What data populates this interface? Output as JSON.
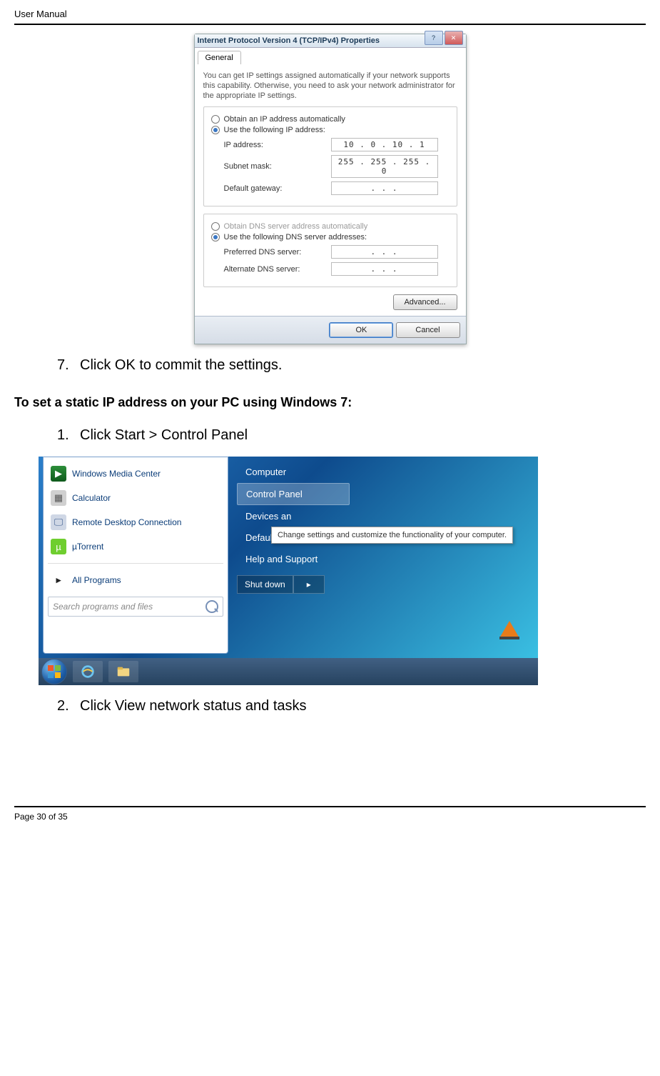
{
  "header": {
    "title": "User Manual"
  },
  "footer": {
    "page_label": "Page 30 of 35"
  },
  "steps_a": [
    {
      "num": "7.",
      "text": "Click OK to commit the settings."
    }
  ],
  "section_heading": "To set a static IP address on your PC using Windows 7:",
  "steps_b": [
    {
      "num": "1.",
      "text": "Click Start > Control Panel"
    },
    {
      "num": "2.",
      "text": "Click View network status and tasks"
    }
  ],
  "dialog": {
    "title": "Internet Protocol Version 4 (TCP/IPv4) Properties",
    "tab": "General",
    "body_text": "You can get IP settings assigned automatically if your network supports this capability. Otherwise, you need to ask your network administrator for the appropriate IP settings.",
    "opt_auto_ip": "Obtain an IP address automatically",
    "opt_use_ip": "Use the following IP address:",
    "lbl_ip": "IP address:",
    "val_ip": "10 .  0  . 10 .  1",
    "lbl_mask": "Subnet mask:",
    "val_mask": "255 . 255 . 255 .  0",
    "lbl_gw": "Default gateway:",
    "val_gw": ".      .      .",
    "opt_auto_dns": "Obtain DNS server address automatically",
    "opt_use_dns": "Use the following DNS server addresses:",
    "lbl_pref": "Preferred DNS server:",
    "val_pref": ".      .      .",
    "lbl_alt": "Alternate DNS server:",
    "val_alt": ".      .      .",
    "btn_advanced": "Advanced...",
    "btn_ok": "OK",
    "btn_cancel": "Cancel"
  },
  "startmenu": {
    "left_items": [
      "Windows Media Center",
      "Calculator",
      "Remote Desktop Connection",
      "µTorrent"
    ],
    "all_programs": "All Programs",
    "search_placeholder": "Search programs and files",
    "right_top_item": "Computer",
    "right_items": [
      "Control Panel",
      "Devices an",
      "Default Programs",
      "Help and Support"
    ],
    "shutdown": "Shut down",
    "tooltip": "Change settings and customize the functionality of your computer."
  }
}
